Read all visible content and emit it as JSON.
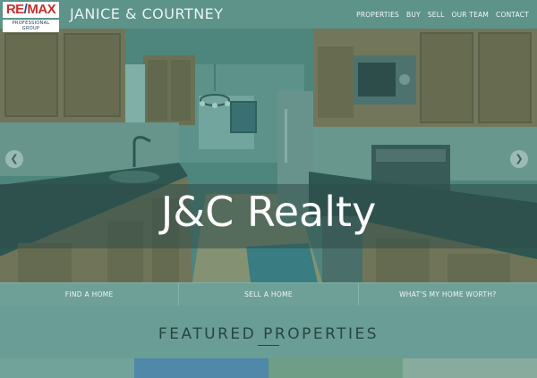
{
  "header": {
    "logo_text_a": "RE",
    "logo_slash": "/",
    "logo_text_b": "MAX",
    "logo_sub": "PROFESSIONAL GROUP",
    "brand": "JANICE & COURTNEY",
    "nav": [
      "PROPERTIES",
      "BUY",
      "SELL",
      "OUR TEAM",
      "CONTACT"
    ]
  },
  "hero": {
    "title": "J&C Realty",
    "prev_icon": "chevron-left-icon",
    "next_icon": "chevron-right-icon",
    "prev_glyph": "❮",
    "next_glyph": "❯"
  },
  "quick_links": [
    "FIND A HOME",
    "SELL A HOME",
    "WHAT'S MY HOME WORTH?"
  ],
  "featured": {
    "title": "FEATURED PROPERTIES"
  },
  "colors": {
    "overlay": "#5e938a",
    "title_text": "#ffffff",
    "featured_text": "#254741"
  }
}
